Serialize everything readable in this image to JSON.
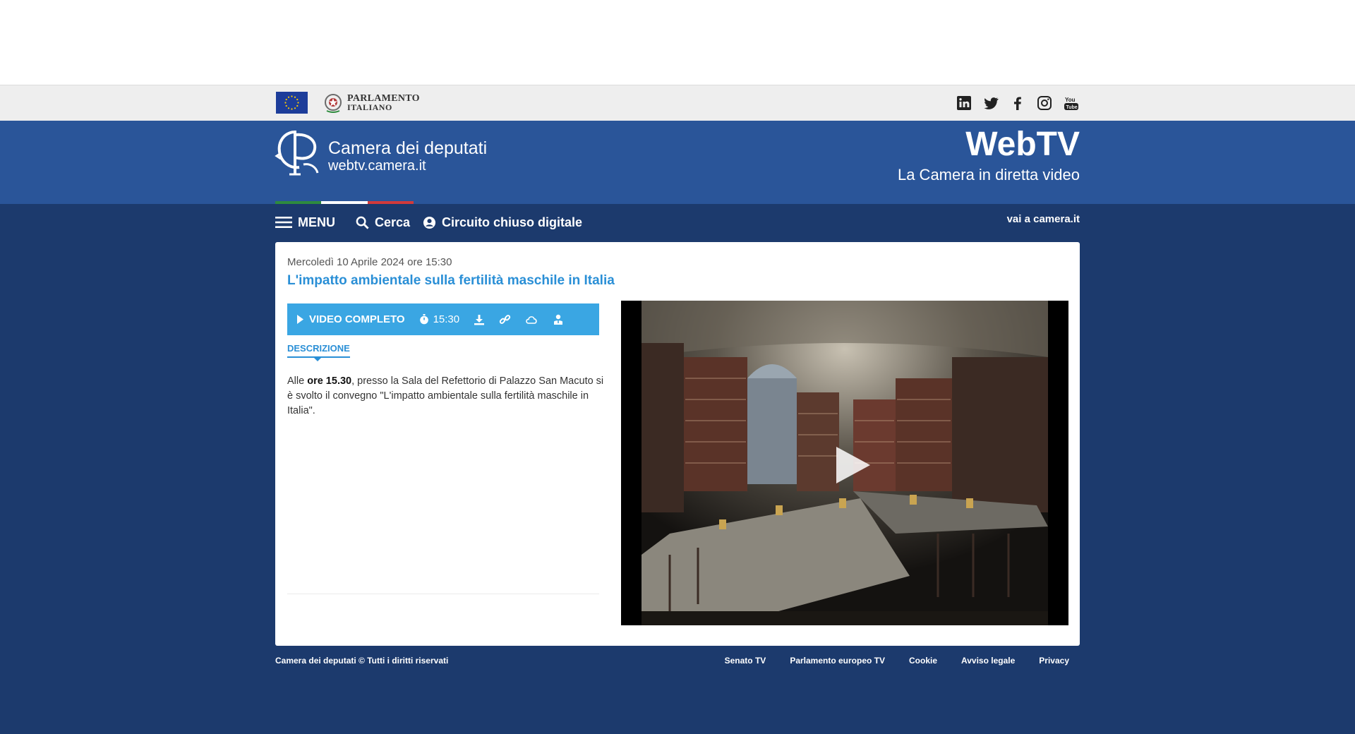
{
  "topbar": {
    "brand": {
      "line1": "PARLAMENTO",
      "line2": "ITALIANO"
    },
    "social_icons": [
      "linkedin-icon",
      "twitter-icon",
      "facebook-icon",
      "instagram-icon",
      "youtube-icon"
    ]
  },
  "header": {
    "site_title": "Camera dei deputati",
    "site_url": "webtv.camera.it",
    "webtv": "WebTV",
    "tagline": "La Camera in diretta video",
    "tricolor": [
      "#2e8b3e",
      "#ffffff",
      "#d23a3a"
    ]
  },
  "nav": {
    "menu": "MENU",
    "search": "Cerca",
    "circuit": "Circuito chiuso digitale",
    "external": "vai a camera.it"
  },
  "content": {
    "date": "Mercoledì 10 Aprile 2024 ore 15:30",
    "title": "L'impatto ambientale sulla fertilità maschile in Italia",
    "toolbar": {
      "video_label": "VIDEO COMPLETO",
      "time": "15:30"
    },
    "tab": "DESCRIZIONE",
    "description": {
      "part1": "Alle ",
      "bold": "ore 15.30",
      "part2": ", presso la Sala del Refettorio di Palazzo San Macuto si è svolto il convegno \"L'impatto ambientale sulla fertilità maschile in Italia\"."
    }
  },
  "footer": {
    "copyright": "Camera dei deputati © Tutti i diritti riservati",
    "links": [
      "Senato TV",
      "Parlamento europeo TV",
      "Cookie",
      "Avviso legale",
      "Privacy"
    ]
  },
  "colors": {
    "header_blue": "#2a5599",
    "dark_blue": "#1c3a6d",
    "accent_blue": "#3aa6e3",
    "link_blue": "#2a8fd6"
  }
}
